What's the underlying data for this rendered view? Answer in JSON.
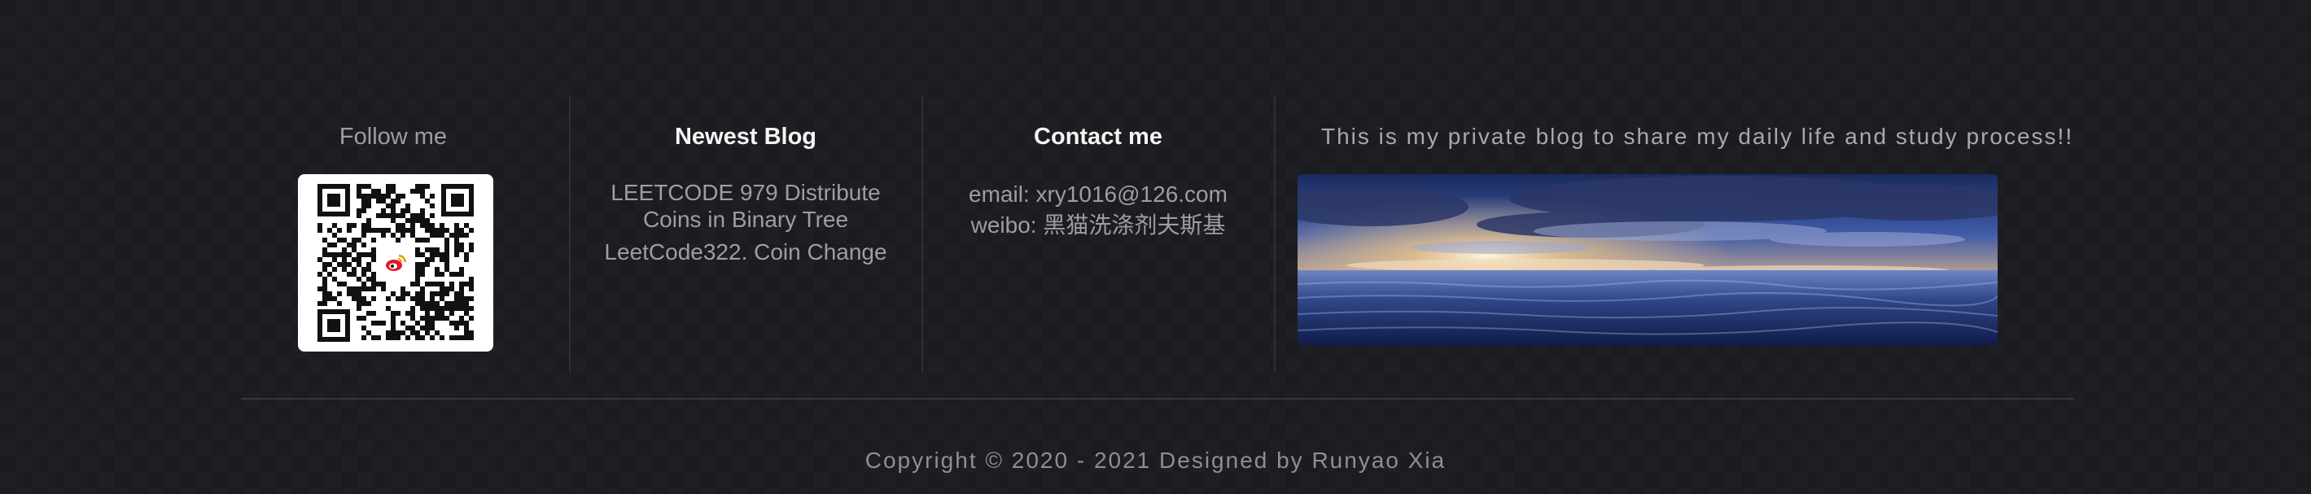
{
  "follow": {
    "heading": "Follow me",
    "qr_icon": "weibo-qr-code"
  },
  "blog": {
    "heading": "Newest Blog",
    "posts": [
      {
        "title": "LEETCODE 979 Distribute Coins in Binary Tree"
      },
      {
        "title": "LeetCode322. Coin Change"
      }
    ]
  },
  "contact": {
    "heading": "Contact me",
    "email_line": "email: xry1016@126.com",
    "weibo_line": "weibo: 黑猫洗涤剂夫斯基"
  },
  "about": {
    "text": "This is my private blog to share my daily life and study process!!",
    "image_icon": "ocean-sunset-image"
  },
  "footer": {
    "copyright": "Copyright © 2020 - 2021 Designed by Runyao Xia"
  },
  "colors": {
    "background": "#1b1c1f",
    "muted_text": "#9c9ea3",
    "heading_text": "#f4f4f5",
    "divider": "#2f3034"
  }
}
